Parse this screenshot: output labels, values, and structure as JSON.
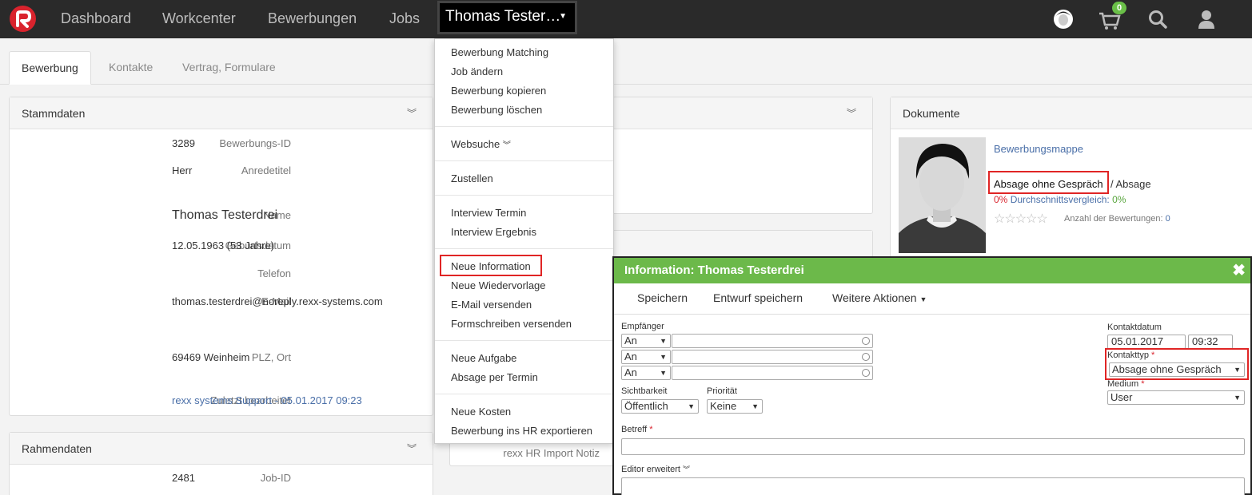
{
  "nav": {
    "links": [
      "Dashboard",
      "Workcenter",
      "Bewerbungen",
      "Jobs"
    ],
    "user_menu": "Thomas Tester…",
    "cart_count": "0"
  },
  "tabs": [
    "Bewerbung",
    "Kontakte",
    "Vertrag, Formulare"
  ],
  "stammdaten": {
    "title": "Stammdaten",
    "rows": [
      {
        "label": "Bewerbungs-ID",
        "value": "3289"
      },
      {
        "label": "Anredetitel",
        "value": "Herr"
      },
      {
        "label": "Name",
        "value": "Thomas Testerdrei"
      },
      {
        "label": "Geburtsdatum",
        "value": "12.05.1963 (53 Jahre)"
      },
      {
        "label": "Telefon",
        "value": ""
      },
      {
        "label": "E-Mail",
        "value": "thomas.testerdrei@noreply.rexx-systems.com"
      },
      {
        "label": "PLZ, Ort",
        "value": "69469 Weinheim"
      },
      {
        "label": "Zuletzt bearbeitet",
        "value": "rexx systems Support - 05.01.2017 09:23"
      }
    ]
  },
  "rahmendaten": {
    "title": "Rahmendaten",
    "rows": [
      {
        "label": "Job-ID",
        "value": "2481"
      }
    ]
  },
  "middle_panel": {
    "note": "rexx HR Import Notiz"
  },
  "menu": {
    "groups": [
      [
        "Bewerbung Matching",
        "Job ändern",
        "Bewerbung kopieren",
        "Bewerbung löschen"
      ],
      [
        "Websuche"
      ],
      [
        "Zustellen"
      ],
      [
        "Interview Termin",
        "Interview Ergebnis"
      ],
      [
        "Neue Information",
        "Neue Wiedervorlage",
        "E-Mail versenden",
        "Formschreiben versenden"
      ],
      [
        "Neue Aufgabe",
        "Absage per Termin"
      ],
      [
        "Neue Kosten",
        "Bewerbung ins HR exportieren"
      ]
    ]
  },
  "dokumente": {
    "title": "Dokumente",
    "link": "Bewerbungsmappe",
    "status": "Absage ohne Gespräch",
    "status_suffix": "/ Absage",
    "percent": "0%",
    "compare_label": "Durchschnittsvergleich:",
    "compare_value": "0%",
    "rating_label": "Anzahl der Bewertungen:",
    "rating_count": "0"
  },
  "modal": {
    "title": "Information: Thomas Testerdrei",
    "toolbar": {
      "save": "Speichern",
      "draft": "Entwurf speichern",
      "more": "Weitere Aktionen"
    },
    "empfaenger_label": "Empfänger",
    "recipients": [
      "An",
      "An",
      "An"
    ],
    "kontaktdatum_label": "Kontaktdatum",
    "kontaktdatum": "05.01.2017",
    "kontaktzeit": "09:32",
    "kontakttyp_label": "Kontakttyp",
    "kontakttyp": "Absage ohne Gespräch",
    "medium_label": "Medium",
    "medium": "User",
    "sichtbarkeit_label": "Sichtbarkeit",
    "sichtbarkeit": "Öffentlich",
    "prioritaet_label": "Priorität",
    "prioritaet": "Keine",
    "betreff_label": "Betreff",
    "required_mark": "*",
    "editor_label": "Editor erweitert"
  },
  "colors": {
    "brand": "#d9232d",
    "modal_header": "#6cb94a",
    "highlight": "#e02525",
    "link": "#4a6fa8"
  }
}
